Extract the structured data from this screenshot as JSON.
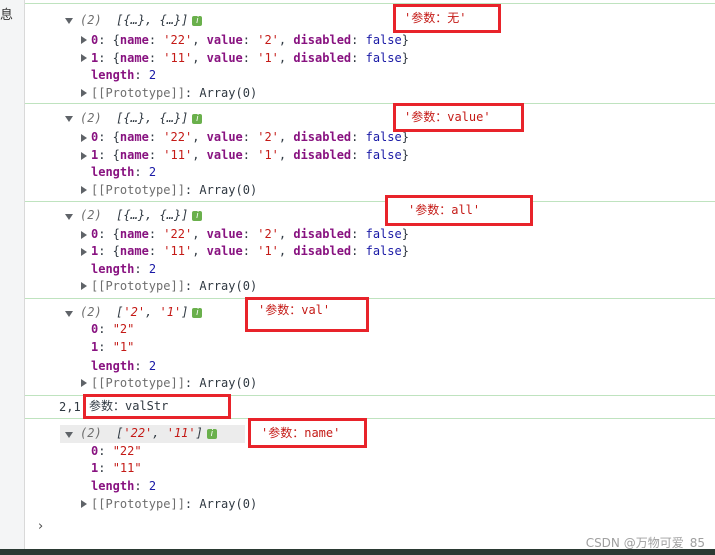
{
  "left_glyph": "息",
  "annotations": [
    "'参数：无'",
    "'参数：value'",
    "'参数：all'",
    "'参数：val'",
    "参数：valStr",
    "'参数：name'"
  ],
  "groups": [
    {
      "count": "(2)",
      "preview": "[{…}, {…}]",
      "items": [
        {
          "key": "0",
          "name": "'22'",
          "value": "'2'",
          "disabled": "false"
        },
        {
          "key": "1",
          "name": "'11'",
          "value": "'1'",
          "disabled": "false"
        }
      ],
      "length_key": "length",
      "length_val": "2",
      "proto": "[[Prototype]]",
      "proto_val": "Array(0)"
    },
    {
      "count": "(2)",
      "preview": "[{…}, {…}]",
      "items": [
        {
          "key": "0",
          "name": "'22'",
          "value": "'2'",
          "disabled": "false"
        },
        {
          "key": "1",
          "name": "'11'",
          "value": "'1'",
          "disabled": "false"
        }
      ],
      "length_key": "length",
      "length_val": "2",
      "proto": "[[Prototype]]",
      "proto_val": "Array(0)"
    },
    {
      "count": "(2)",
      "preview": "[{…}, {…}]",
      "items": [
        {
          "key": "0",
          "name": "'22'",
          "value": "'2'",
          "disabled": "false"
        },
        {
          "key": "1",
          "name": "'11'",
          "value": "'1'",
          "disabled": "false"
        }
      ],
      "length_key": "length",
      "length_val": "2",
      "proto": "[[Prototype]]",
      "proto_val": "Array(0)"
    },
    {
      "count": "(2)",
      "preview_open": "[",
      "preview_a": "'2'",
      "preview_sep": ", ",
      "preview_b": "'1'",
      "preview_close": "]",
      "items": [
        {
          "key": "0",
          "val": "\"2\""
        },
        {
          "key": "1",
          "val": "\"1\""
        }
      ],
      "length_key": "length",
      "length_val": "2",
      "proto": "[[Prototype]]",
      "proto_val": "Array(0)"
    }
  ],
  "plain_log": "2,1",
  "last_group": {
    "count": "(2)",
    "preview_open": "[",
    "preview_a": "'22'",
    "preview_sep": ", ",
    "preview_b": "'11'",
    "preview_close": "]",
    "items": [
      {
        "key": "0",
        "val": "\"22\""
      },
      {
        "key": "1",
        "val": "\"11\""
      }
    ],
    "length_key": "length",
    "length_val": "2",
    "proto": "[[Prototype]]",
    "proto_val": "Array(0)"
  },
  "prompt": "›",
  "watermark": "CSDN @万物可爱_85"
}
